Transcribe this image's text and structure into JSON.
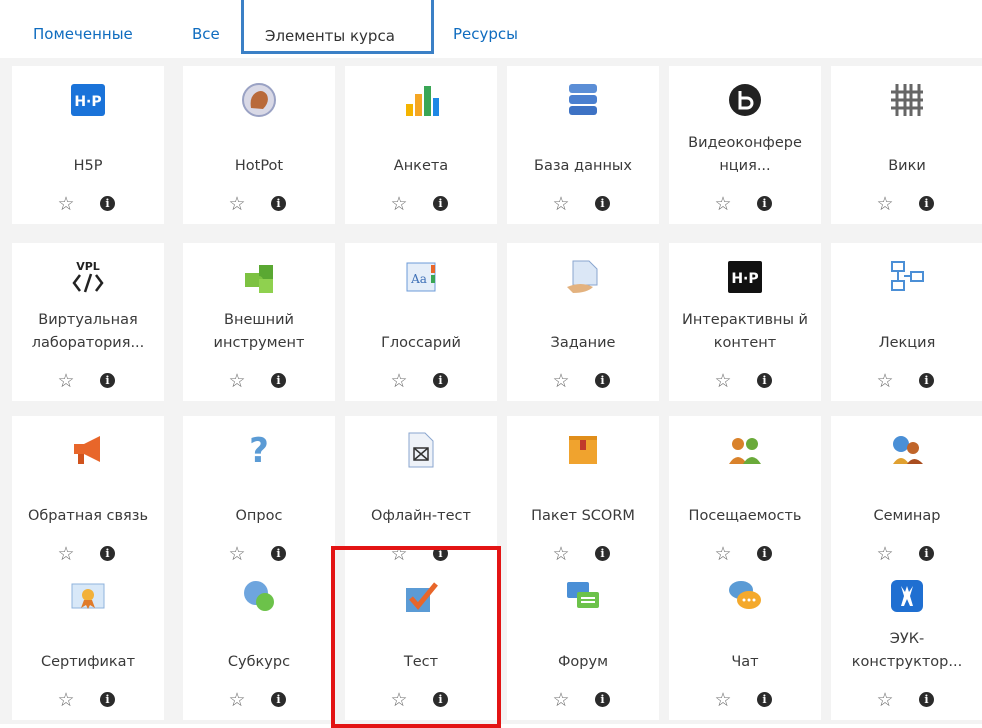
{
  "tabs": [
    {
      "label": "Помеченные"
    },
    {
      "label": "Все"
    },
    {
      "label": "Элементы курса"
    },
    {
      "label": "Ресурсы"
    }
  ],
  "active_tab": "Элементы курса",
  "activities": [
    {
      "label": "H5P",
      "icon": "h5p-icon"
    },
    {
      "label": "HotPot",
      "icon": "hotpot-icon"
    },
    {
      "label": "Анкета",
      "icon": "survey-chart-icon"
    },
    {
      "label": "База данных",
      "icon": "database-icon"
    },
    {
      "label": "Видеоконфере нция...",
      "icon": "bigbluebutton-icon"
    },
    {
      "label": "Вики",
      "icon": "wiki-icon"
    },
    {
      "label": "Виртуальная лаборатория...",
      "icon": "vpl-icon"
    },
    {
      "label": "Внешний инструмент",
      "icon": "puzzle-icon"
    },
    {
      "label": "Глоссарий",
      "icon": "glossary-icon"
    },
    {
      "label": "Задание",
      "icon": "assignment-icon"
    },
    {
      "label": "Интерактивны й контент",
      "icon": "h5p-dark-icon"
    },
    {
      "label": "Лекция",
      "icon": "lesson-icon"
    },
    {
      "label": "Обратная связь",
      "icon": "megaphone-icon"
    },
    {
      "label": "Опрос",
      "icon": "question-mark-icon"
    },
    {
      "label": "Офлайн-тест",
      "icon": "offline-quiz-icon"
    },
    {
      "label": "Пакет SCORM",
      "icon": "scorm-package-icon"
    },
    {
      "label": "Посещаемость",
      "icon": "attendance-icon"
    },
    {
      "label": "Семинар",
      "icon": "workshop-icon"
    },
    {
      "label": "Сертификат",
      "icon": "certificate-icon"
    },
    {
      "label": "Субкурс",
      "icon": "subcourse-icon"
    },
    {
      "label": "Тест",
      "icon": "quiz-checkmark-icon"
    },
    {
      "label": "Форум",
      "icon": "forum-icon"
    },
    {
      "label": "Чат",
      "icon": "chat-icon"
    },
    {
      "label": "ЭУК-конструктор...",
      "icon": "deer-icon"
    }
  ],
  "star_glyph": "☆",
  "info_glyph": "i",
  "colors": {
    "link": "#0f6cbf",
    "active_tab_border": "#3b80c6",
    "highlight": "#e31414"
  }
}
